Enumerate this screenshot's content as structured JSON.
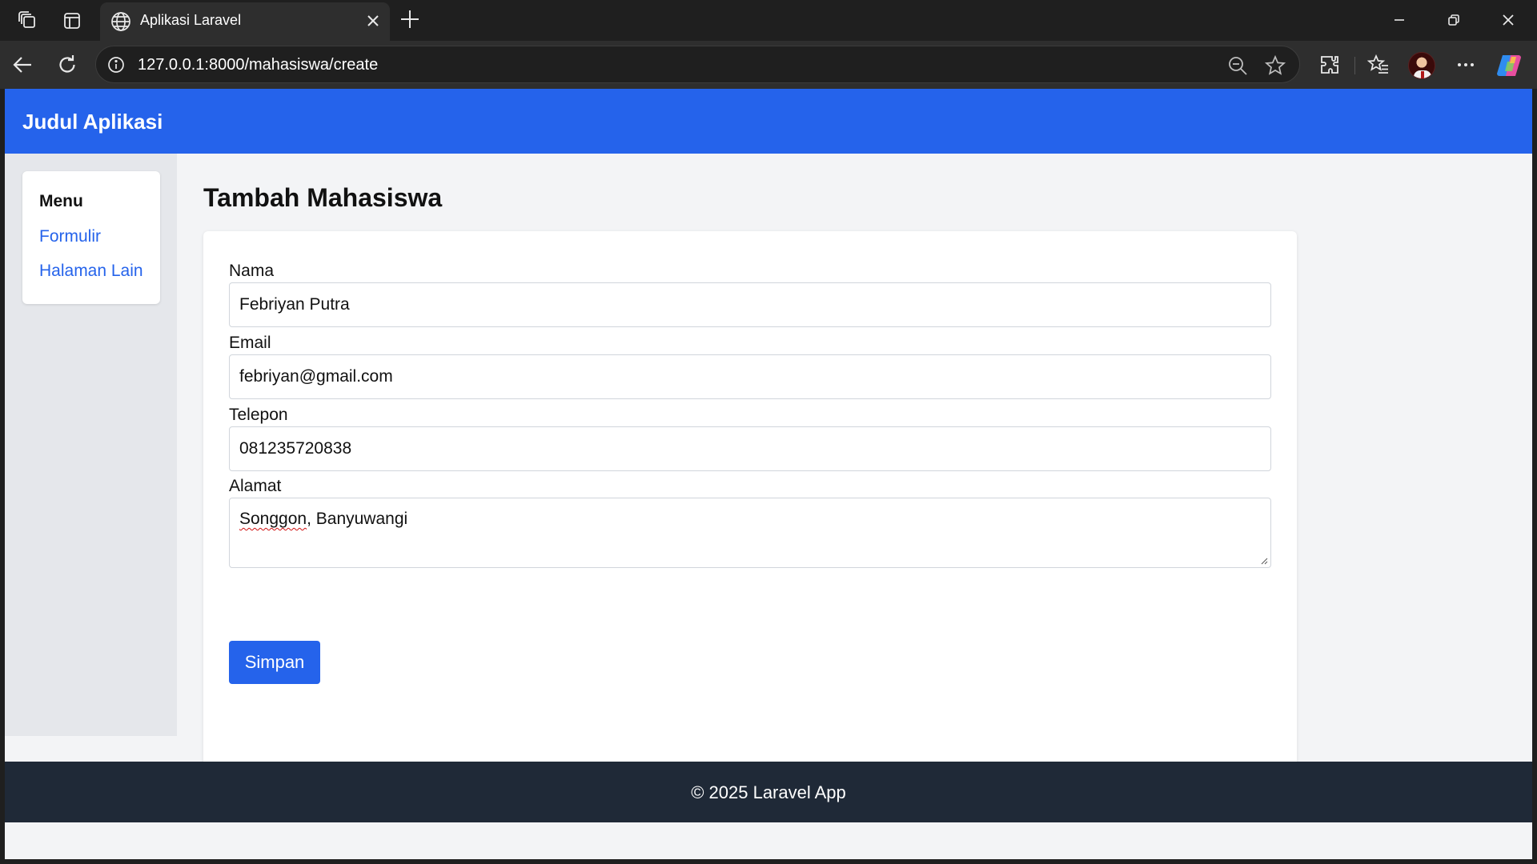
{
  "browser": {
    "tab_title": "Aplikasi Laravel",
    "url": "127.0.0.1:8000/mahasiswa/create"
  },
  "app": {
    "title": "Judul Aplikasi"
  },
  "sidebar": {
    "heading": "Menu",
    "items": [
      {
        "label": "Formulir"
      },
      {
        "label": "Halaman Lain"
      }
    ]
  },
  "main": {
    "page_title": "Tambah Mahasiswa",
    "form": {
      "fields": [
        {
          "label": "Nama",
          "value": "Febriyan Putra"
        },
        {
          "label": "Email",
          "value": "febriyan@gmail.com"
        },
        {
          "label": "Telepon",
          "value": "081235720838"
        }
      ],
      "address": {
        "label": "Alamat",
        "value_misspelled": "Songgon",
        "value_rest": ", Banyuwangi"
      },
      "submit_label": "Simpan"
    }
  },
  "footer": {
    "text": "© 2025 Laravel App"
  },
  "colors": {
    "accent": "#2563eb",
    "footer_bg": "#1f2937",
    "sidebar_bg": "#e5e7eb",
    "content_bg": "#f3f4f6"
  },
  "icons": [
    "workspaces-icon",
    "tab-actions-icon",
    "globe-icon",
    "close-tab-icon",
    "new-tab-icon",
    "minimize-icon",
    "restore-icon",
    "close-window-icon",
    "back-icon",
    "refresh-icon",
    "site-info-icon",
    "zoom-out-icon",
    "favorite-star-icon",
    "extensions-icon",
    "favorites-icon",
    "profile-avatar",
    "more-icon",
    "copilot-icon"
  ]
}
